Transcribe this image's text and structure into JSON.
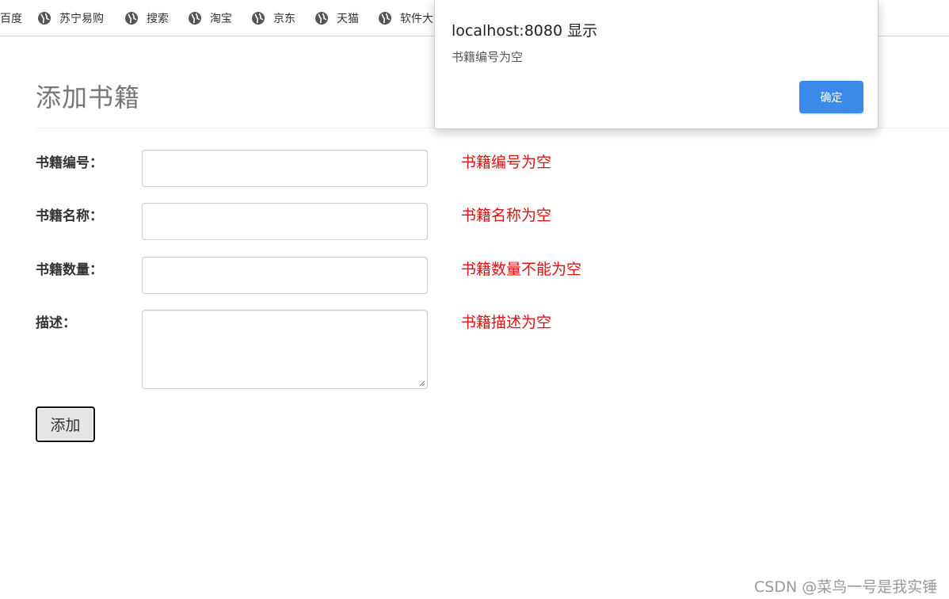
{
  "bookmarks": [
    {
      "label": "百度",
      "icon": null
    },
    {
      "label": "苏宁易购",
      "icon": "globe-icon"
    },
    {
      "label": "搜索",
      "icon": "globe-icon"
    },
    {
      "label": "淘宝",
      "icon": "globe-icon"
    },
    {
      "label": "京东",
      "icon": "globe-icon"
    },
    {
      "label": "天猫",
      "icon": "globe-icon"
    },
    {
      "label": "软件大",
      "icon": "globe-icon"
    }
  ],
  "page": {
    "title": "添加书籍"
  },
  "form": {
    "fields": [
      {
        "label": "书籍编号：",
        "value": "",
        "error": "书籍编号为空"
      },
      {
        "label": "书籍名称：",
        "value": "",
        "error": "书籍名称为空"
      },
      {
        "label": "书籍数量：",
        "value": "",
        "error": "书籍数量不能为空"
      },
      {
        "label": "描述：",
        "value": "",
        "error": "书籍描述为空"
      }
    ],
    "submit_label": "添加"
  },
  "dialog": {
    "title": "localhost:8080 显示",
    "message": "书籍编号为空",
    "ok_label": "确定"
  },
  "watermark": "CSDN @菜鸟一号是我实锤",
  "colors": {
    "error": "#e01010",
    "dialog_button": "#3c8ae8",
    "globe_icon": "#555555"
  }
}
